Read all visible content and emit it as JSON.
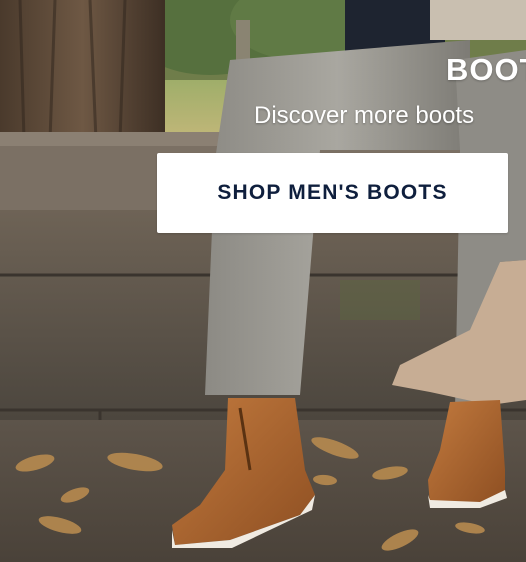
{
  "hero": {
    "headline": "BOOT",
    "subheadline": "Discover more boots",
    "cta_label": "SHOP MEN'S BOOTS"
  },
  "colors": {
    "cta_background": "#ffffff",
    "cta_text": "#0f1f3d",
    "overlay_text": "#ffffff"
  }
}
